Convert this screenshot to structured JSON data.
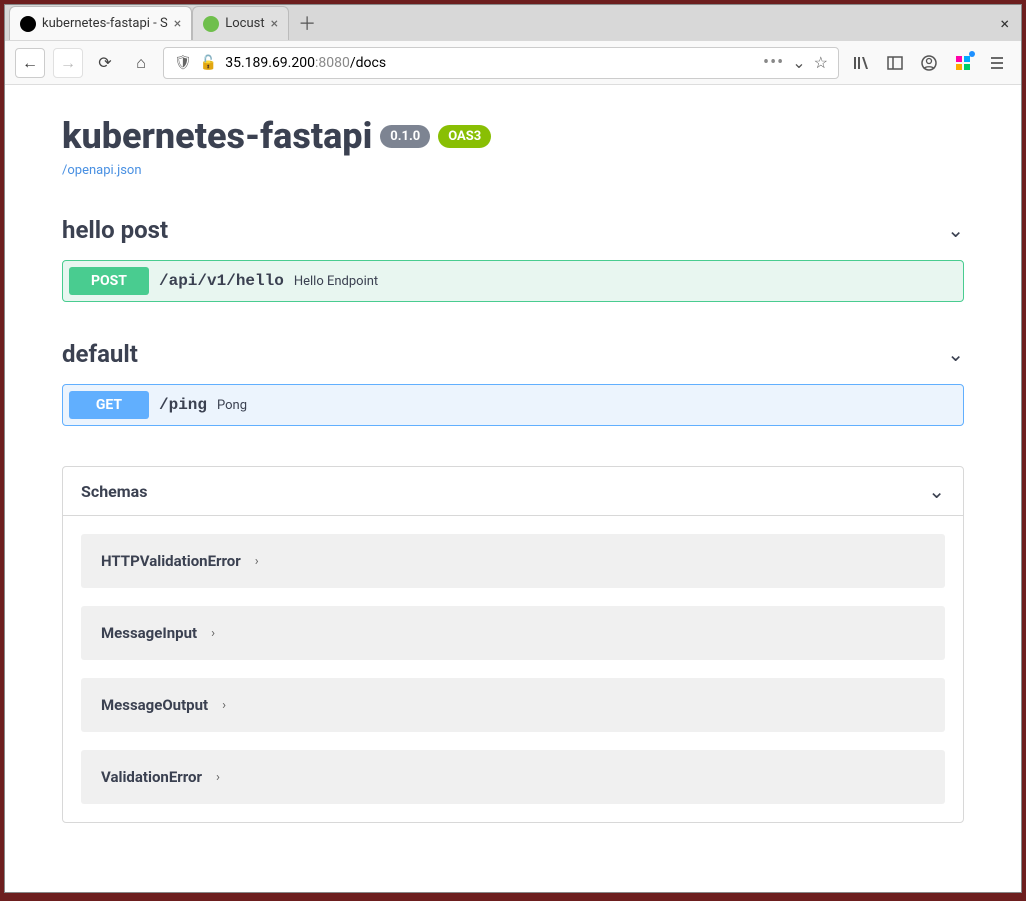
{
  "browser": {
    "tabs": [
      {
        "label": "kubernetes-fastapi - S",
        "active": true,
        "favicon_bg": "#000"
      },
      {
        "label": "Locust",
        "active": false,
        "favicon_bg": "#6fbf4c"
      }
    ],
    "url_host": "35.189.69.200",
    "url_port": ":8080",
    "url_path": "/docs"
  },
  "api": {
    "title": "kubernetes-fastapi",
    "version": "0.1.0",
    "oas_badge": "OAS3",
    "openapi_link": "/openapi.json"
  },
  "tags": [
    {
      "name": "hello post",
      "ops": [
        {
          "method": "POST",
          "method_class": "post",
          "path": "/api/v1/hello",
          "summary": "Hello Endpoint"
        }
      ]
    },
    {
      "name": "default",
      "ops": [
        {
          "method": "GET",
          "method_class": "get",
          "path": "/ping",
          "summary": "Pong"
        }
      ]
    }
  ],
  "schemas": {
    "title": "Schemas",
    "items": [
      "HTTPValidationError",
      "MessageInput",
      "MessageOutput",
      "ValidationError"
    ]
  }
}
